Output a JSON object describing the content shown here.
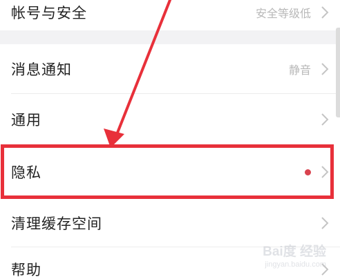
{
  "settings": {
    "items": [
      {
        "label": "帐号与安全",
        "value": "安全等级低"
      },
      {
        "label": "消息通知",
        "value": "静音"
      },
      {
        "label": "通用"
      },
      {
        "label": "隐私",
        "badge": "red-dot"
      },
      {
        "label": "清理缓存空间"
      },
      {
        "label": "帮助"
      }
    ]
  },
  "annotation": {
    "highlight_color": "#e8303a",
    "arrow_color": "#e8303a",
    "badge_color": "#d9424e"
  },
  "watermark": {
    "main": "Bai度 经验",
    "sub": "jingyan.baidu.com"
  },
  "icons": {
    "chevron": "chevron-right-icon"
  }
}
